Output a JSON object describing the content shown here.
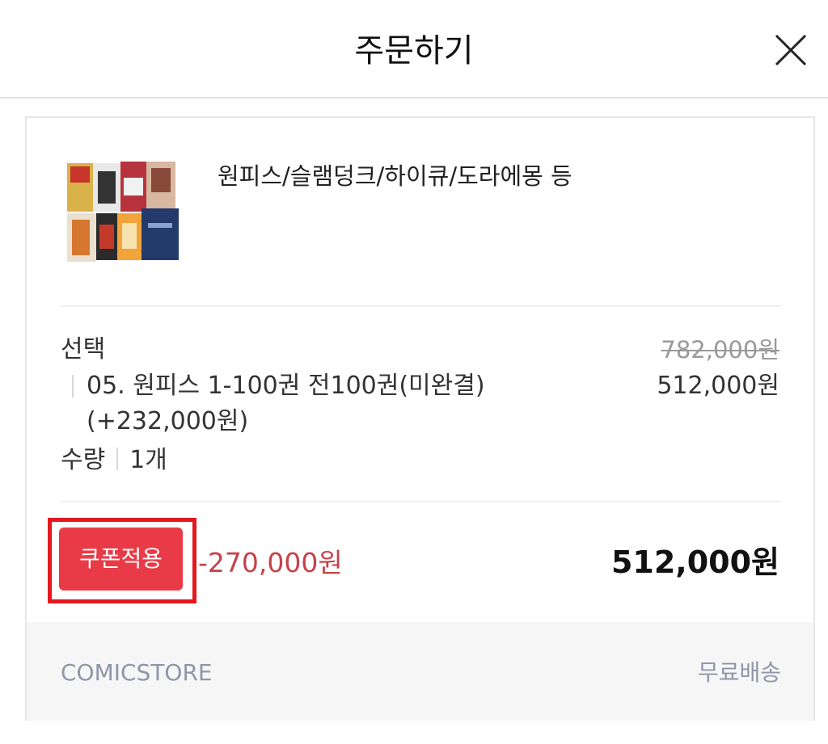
{
  "header": {
    "title": "주문하기",
    "close_icon": "close-icon"
  },
  "product": {
    "name": "원피스/슬램덩크/하이큐/도라에몽 등",
    "image_icon": "product-thumbnail"
  },
  "option": {
    "label": "선택",
    "original_price": "782,000원",
    "text": "05. 원피스 1-100권 전100권(미완결) (+232,000원)",
    "price": "512,000원"
  },
  "quantity": {
    "label": "수량",
    "value": "1개"
  },
  "coupon": {
    "button_label": "쿠폰적용",
    "discount": "-270,000원",
    "total": "512,000원"
  },
  "footer": {
    "seller": "COMICSTORE",
    "shipping": "무료배송"
  },
  "colors": {
    "accent_red": "#e93b47",
    "highlight_red": "#e4181f",
    "discount_red": "#c5424a",
    "muted": "#8f96a8"
  }
}
